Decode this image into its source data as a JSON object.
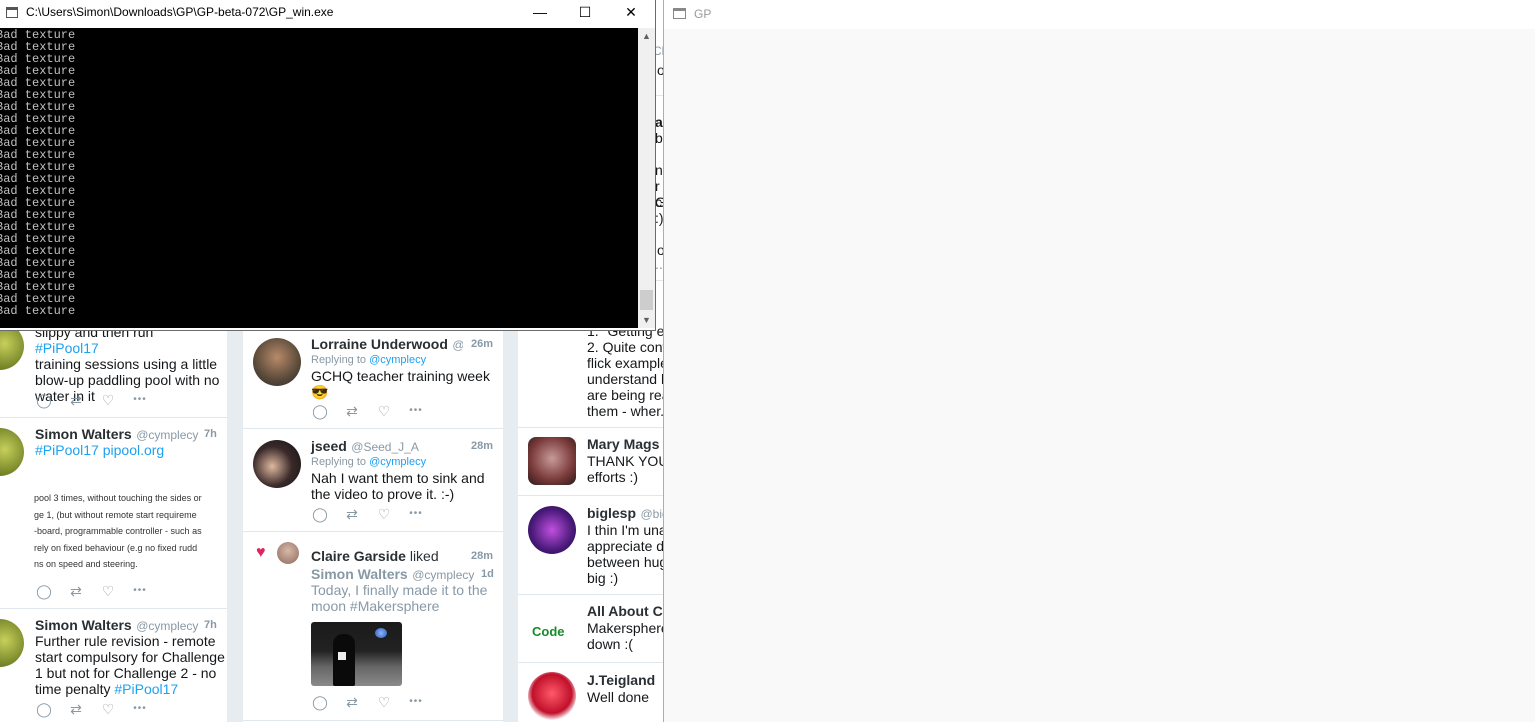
{
  "console": {
    "title": "C:\\Users\\Simon\\Downloads\\GP\\GP-beta-072\\GP_win.exe",
    "lines": [
      "Bad texture",
      "Bad texture",
      "Bad texture",
      "Bad texture",
      "Bad texture",
      "Bad texture",
      "Bad texture",
      "Bad texture",
      "Bad texture",
      "Bad texture",
      "Bad texture",
      "Bad texture",
      "Bad texture",
      "Bad texture",
      "Bad texture",
      "Bad texture",
      "Bad texture",
      "Bad texture",
      "Bad texture",
      "Bad texture",
      "Bad texture",
      "Bad texture",
      "Bad texture",
      "Bad texture"
    ],
    "minimize_glyph": "—",
    "maximize_glyph": "☐",
    "close_glyph": "✕",
    "scroll_up": "▲",
    "scroll_down": "▼"
  },
  "gp": {
    "title": "GP"
  },
  "column1": {
    "tweet_a": {
      "text_lines": [
        "slippy and then run ",
        "training sessions using a little",
        "blow-up paddling pool with no",
        "water in it"
      ],
      "hashtag": "#PiPool17"
    },
    "tweet_b": {
      "name": "Simon Walters",
      "handle": "@cymplecy",
      "time": "7h",
      "hashtag": "#PiPool17",
      "link": "pipool.org",
      "card_lines": [
        "pool 3 times, without touching the sides or",
        "ge 1, (but without remote start requireme",
        "-board, programmable controller - such as",
        "rely on fixed  behaviour (e.g no fixed rudd",
        "ns on speed and steering."
      ]
    },
    "tweet_c": {
      "name": "Simon Walters",
      "handle": "@cymplecy",
      "time": "7h",
      "text_lines": [
        "Further rule revision - remote",
        "start compulsory for Challenge",
        "1 but not for Challenge 2 - no",
        "time penalty "
      ],
      "hashtag": "#PiPool17"
    }
  },
  "column2": {
    "tweet_a": {
      "name": "Lorraine Underwood",
      "handle": "@...",
      "time": "26m",
      "reply_prefix": "Replying to ",
      "reply_handle": "@cymplecy",
      "text": "GCHQ teacher training week",
      "emoji": "😎"
    },
    "tweet_b": {
      "name": "jseed",
      "handle": "@Seed_J_A",
      "time": "28m",
      "reply_prefix": "Replying to ",
      "reply_handle": "@cymplecy",
      "text_lines": [
        "Nah I want them to sink and",
        "the video to prove it. :-)"
      ]
    },
    "tweet_c": {
      "liker": "Claire Garside",
      "liked_word": "liked",
      "time": "28m",
      "quoted_name": "Simon Walters",
      "quoted_handle": "@cymplecy",
      "quoted_time": "1d",
      "quoted_lines": [
        "Today, I finally made it to the",
        "moon #Makersphere"
      ]
    }
  },
  "column3": {
    "top_fragments": [
      "Cle",
      "o",
      "al",
      "bo",
      "ng",
      "r c",
      "G",
      ":)",
      "o",
      "..."
    ],
    "tweet_a_lines": [
      "1. \"Getting er",
      "2. Quite confu",
      "flick examples",
      "understand h",
      "are being rea",
      "them - wher..."
    ],
    "tweet_b": {
      "name": "Mary Mags F",
      "text_lines": [
        "THANK YOU",
        "efforts :)"
      ]
    },
    "tweet_c": {
      "name": "biglesp",
      "handle": "@bigl",
      "text_lines": [
        "I thin I'm unab",
        "appreciate dif",
        "between huge",
        "big :)"
      ]
    },
    "tweet_d": {
      "name": "All About Co",
      "text_lines": [
        "Makersphere",
        "down :("
      ]
    },
    "tweet_e": {
      "name": "J.Teigland",
      "text": "Well done"
    }
  },
  "icons": {
    "reply": "◯",
    "retweet": "⇄",
    "like": "♡",
    "more": "•••",
    "heart_filled": "♥"
  },
  "colors": {
    "link": "#1da1f2",
    "console_bg": "#000000",
    "like_red": "#e0245e"
  }
}
